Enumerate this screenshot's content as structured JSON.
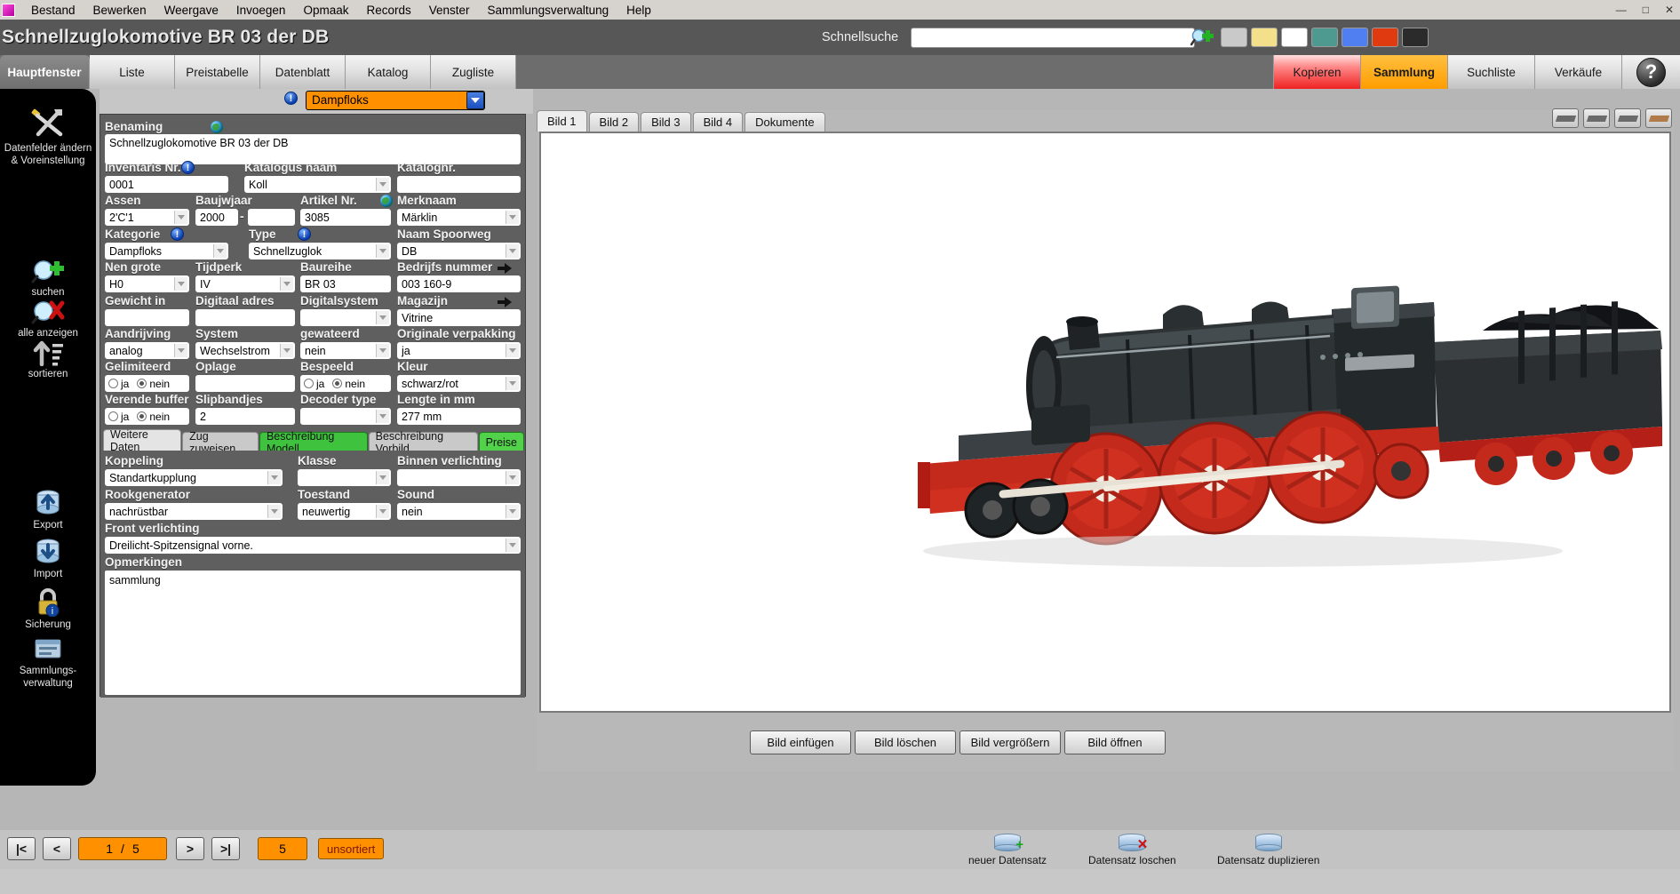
{
  "menubar": {
    "items": [
      "Bestand",
      "Bewerken",
      "Weergave",
      "Invoegen",
      "Opmaak",
      "Records",
      "Venster",
      "Sammlungsverwaltung",
      "Help"
    ],
    "window_buttons": [
      "—",
      "□",
      "✕"
    ]
  },
  "titlebar": {
    "title": "Schnellzuglokomotive BR 03 der DB",
    "quicksearch_label": "Schnellsuche",
    "quicksearch_value": "",
    "quicksearch_placeholder": "",
    "swatch_colors": [
      "#c9c9c9",
      "#f4e08a",
      "#ffffff",
      "#4f9a90",
      "#4f7ff0",
      "#e03a10",
      "#2b2b2b"
    ]
  },
  "main_tabs": {
    "left": [
      "Hauptfenster",
      "Liste",
      "Preistabelle",
      "Datenblatt",
      "Katalog",
      "Zugliste"
    ],
    "active_left": "Hauptfenster",
    "right": [
      "Kopieren",
      "Sammlung",
      "Suchliste",
      "Verkäufe"
    ],
    "right_colors": {
      "Kopieren": "#ef2222",
      "Sammlung": "#ff9d00"
    },
    "help_glyph": "?"
  },
  "sidebar": {
    "items": [
      {
        "label": "Datenfelder ändern & Voreinstellung",
        "icon": "tools-icon"
      },
      {
        "label": "suchen",
        "icon": "search-globe-icon"
      },
      {
        "label": "alle anzeigen",
        "icon": "show-all-icon"
      },
      {
        "label": "sortieren",
        "icon": "sort-icon"
      },
      {
        "label": "Export",
        "icon": "export-db-icon"
      },
      {
        "label": "Import",
        "icon": "import-db-icon"
      },
      {
        "label": "Sicherung",
        "icon": "lock-icon"
      },
      {
        "label": "Sammlungs-verwaltung",
        "icon": "collection-icon"
      }
    ]
  },
  "category_header": {
    "value": "Dampfloks",
    "icon": "info-icon"
  },
  "form": {
    "benaming": {
      "label": "Benaming",
      "value": "Schnellzuglokomotive BR 03 der DB",
      "icon": "globe-icon"
    },
    "rows": [
      {
        "label": "Inventaris Nr.",
        "value": "0001",
        "icon": "info-icon"
      },
      {
        "label": "Katalogus naam",
        "value": "Koll",
        "type": "select"
      },
      {
        "label": "Katalognr.",
        "value": ""
      },
      {
        "label": "Assen",
        "value": "2'C'1",
        "type": "select"
      },
      {
        "label": "Baujwjaar",
        "value": "2000"
      },
      {
        "label": "Baujwjaar2",
        "value": ""
      },
      {
        "label": "Artikel Nr.",
        "value": "3085",
        "icon": "globe-icon"
      },
      {
        "label": "Merknaam",
        "value": "Märklin",
        "type": "select"
      },
      {
        "label": "Kategorie",
        "value": "Dampfloks",
        "type": "select",
        "icon": "info-icon"
      },
      {
        "label": "Type",
        "value": "Schnellzuglok",
        "type": "select",
        "icon": "info-icon"
      },
      {
        "label": "Naam Spoorweg",
        "value": "DB",
        "type": "select"
      },
      {
        "label": "Nen grote",
        "value": "H0",
        "type": "select"
      },
      {
        "label": "Tijdperk",
        "value": "IV",
        "type": "select"
      },
      {
        "label": "Baureihe",
        "value": "BR 03"
      },
      {
        "label": "Bedrijfs nummer",
        "value": "003 160-9",
        "icon": "arrow-right-icon"
      },
      {
        "label": "Gewicht in",
        "value": ""
      },
      {
        "label": "Digitaal adres",
        "value": ""
      },
      {
        "label": "Digitalsystem",
        "value": "",
        "type": "select"
      },
      {
        "label": "Magazijn",
        "value": "Vitrine",
        "icon": "arrow-right-icon"
      },
      {
        "label": "Aandrijving",
        "value": "analog",
        "type": "select"
      },
      {
        "label": "System",
        "value": "Wechselstrom",
        "type": "select"
      },
      {
        "label": "gewateerd",
        "value": "nein",
        "type": "select"
      },
      {
        "label": "Originale verpakking",
        "value": "ja",
        "type": "select"
      },
      {
        "label": "Gelimiteerd",
        "value": "nein",
        "type": "radio"
      },
      {
        "label": "Oplage",
        "value": ""
      },
      {
        "label": "Bespeeld",
        "value": "nein",
        "type": "radio"
      },
      {
        "label": "Kleur",
        "value": "schwarz/rot",
        "type": "select"
      },
      {
        "label": "Verende buffer",
        "value": "nein",
        "type": "radio"
      },
      {
        "label": "Slipbandjes",
        "value": "2"
      },
      {
        "label": "Decoder type",
        "value": "",
        "type": "select"
      },
      {
        "label": "Lengte in mm",
        "value": "277 mm"
      }
    ],
    "radio_options": [
      "ja",
      "nein"
    ]
  },
  "sub_tabs": {
    "items": [
      "Weitere Daten",
      "Zug zuweisen",
      "Beschreibung Modell",
      "Beschreibung Vorbild",
      "Preise"
    ],
    "active": "Weitere Daten",
    "green": [
      "Beschreibung Modell",
      "Preise"
    ]
  },
  "sub_form": {
    "koppeling": {
      "label": "Koppeling",
      "value": "Standartkupplung"
    },
    "klasse": {
      "label": "Klasse",
      "value": ""
    },
    "binnen": {
      "label": "Binnen verlichting",
      "value": ""
    },
    "rookgenerator": {
      "label": "Rookgenerator",
      "value": "nachrüstbar"
    },
    "toestand": {
      "label": "Toestand",
      "value": "neuwertig"
    },
    "sound": {
      "label": "Sound",
      "value": "nein"
    },
    "front": {
      "label": "Front verlichting",
      "value": "Dreilicht-Spitzensignal vorne."
    },
    "opmerkingen": {
      "label": "Opmerkingen",
      "value": "sammlung"
    }
  },
  "image_panel": {
    "tabs": [
      "Bild 1",
      "Bild 2",
      "Bild 3",
      "Bild 4",
      "Dokumente"
    ],
    "active_tab": "Bild 1",
    "view_buttons": [
      "view-1",
      "view-2",
      "view-3",
      "view-4"
    ],
    "buttons": [
      "Bild einfügen",
      "Bild löschen",
      "Bild vergrößern",
      "Bild öffnen"
    ],
    "photo_caption": "BR 03 steam locomotive model photo"
  },
  "bottom": {
    "nav": [
      "|<",
      "<",
      ">",
      ">|"
    ],
    "page_current": "1",
    "page_sep": "/",
    "page_total": "5",
    "record_count": "5",
    "sort_state": "unsortiert",
    "actions": [
      {
        "label": "neuer Datensatz",
        "badge": "+",
        "badge_color": "#1aa81a"
      },
      {
        "label": "Datensatz loschen",
        "badge": "✕",
        "badge_color": "#d01010"
      },
      {
        "label": "Datensatz duplizieren",
        "badge": "",
        "badge_color": ""
      }
    ]
  }
}
